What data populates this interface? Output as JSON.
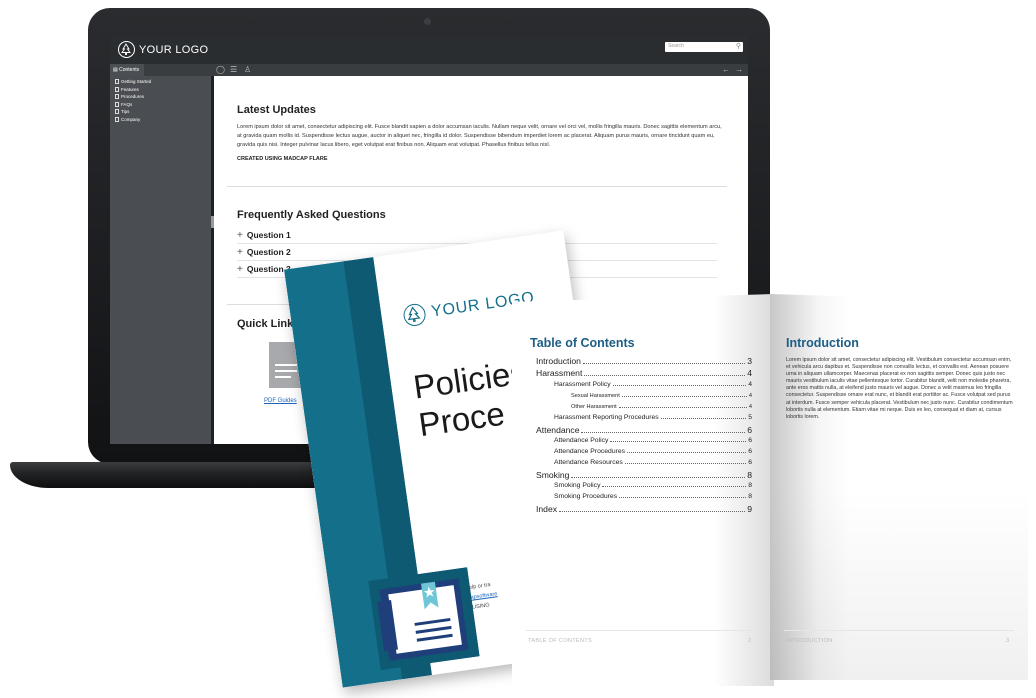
{
  "laptop": {
    "header": {
      "logo_text": "YOUR LOGO",
      "search_placeholder": "Search"
    },
    "toolbar": {
      "contents_tab": "Contents"
    },
    "sidebar": {
      "items": [
        {
          "label": "Getting Started"
        },
        {
          "label": "Features"
        },
        {
          "label": "Procedures"
        },
        {
          "label": "FAQs"
        },
        {
          "label": "Tips"
        },
        {
          "label": "Company"
        }
      ]
    },
    "main": {
      "latest_updates_title": "Latest Updates",
      "latest_updates_text": "Lorem ipsum dolor sit amet, consectetur adipiscing elit. Fusce blandit sapien a dolor accumsan iaculis. Nullam neque velit, ornare vel orci vel, mollis fringilla mauris. Donec sagittis elementum arcu, at gravida quam mollis id. Suspendisse lectus augue, auctor in aliquet nec, fringilla id dolor. Suspendisse bibendum imperdiet lorem ac placerat. Aliquam purus mauris, ornare tincidunt quam eu, gravida quis nisi. Integer pulvinar lacus libero, eget volutpat erat finibus non. Aliquam erat volutpat. Phasellus finibus tellus nisl.",
      "created_label": "CREATED USING MADCAP FLARE",
      "faq_title": "Frequently Asked Questions",
      "faq_items": [
        {
          "label": "Question 1"
        },
        {
          "label": "Question 2"
        },
        {
          "label": "Question 3"
        }
      ],
      "quick_links_title": "Quick Links",
      "pdf_link_label": "PDF Guides"
    }
  },
  "cover": {
    "logo_text": "YOUR LOGO",
    "title_line1": "Policies",
    "title_line2": "Proce",
    "lines": [
      "For more help or tra",
      "http://madcapsoftware",
      "CREATED USING"
    ]
  },
  "book": {
    "toc_title": "Table of Contents",
    "toc_entries": [
      {
        "label": "Introduction",
        "page": "3"
      },
      {
        "label": "Harassment",
        "page": "4"
      },
      {
        "label": "Harassment Policy",
        "page": "4"
      },
      {
        "label": "Sexual Harassment",
        "page": "4"
      },
      {
        "label": "Other Harassment",
        "page": "4"
      },
      {
        "label": "Harassment Reporting Procedures",
        "page": "5"
      },
      {
        "label": "Attendance",
        "page": "6"
      },
      {
        "label": "Attendance Policy",
        "page": "6"
      },
      {
        "label": "Attendance Procedures",
        "page": "6"
      },
      {
        "label": "Attendance Resources",
        "page": "6"
      },
      {
        "label": "Smoking",
        "page": "8"
      },
      {
        "label": "Smoking Policy",
        "page": "8"
      },
      {
        "label": "Smoking Procedures",
        "page": "8"
      },
      {
        "label": "Index",
        "page": "9"
      }
    ],
    "left_footer": "TABLE OF CONTENTS",
    "left_page_number": "2",
    "intro_title": "Introduction",
    "intro_text": "Lorem ipsum dolor sit amet, consectetur adipiscing elit. Vestibulum consectetur accumsan enim, et vehicula arcu dapibus et. Suspendisse non convallis lectus, et convallis est. Aenean posuere urna in aliquam ullamcorper. Maecenas placerat ex non sagittis semper. Donec quis justo nec mauris vestibulum iaculis vitae pellentesque tortor. Curabitur blandit, velit non molestie pharetra, ante eros mattis nulla, at eleifend justo mauris vel augue. Donec a velit maximus leo fringilla consectetur. Suspendisse ornare erat nunc, et blandit erat porttitor ac. Fusce volutpat sed purus at interdum. Fusce semper vehicula placerat. Vestibulum nec justo nunc. Curabitur condimentum lobortis nulla at elementum. Etiam vitae mi neque. Duis ex leo, consequat et diam at, cursus lobortis lorem.",
    "right_footer": "INTRODUCTION",
    "right_page_number": "3"
  },
  "colors": {
    "brand_teal": "#146f8a",
    "heading_blue": "#1c5e86",
    "link_blue": "#1e63b8"
  }
}
